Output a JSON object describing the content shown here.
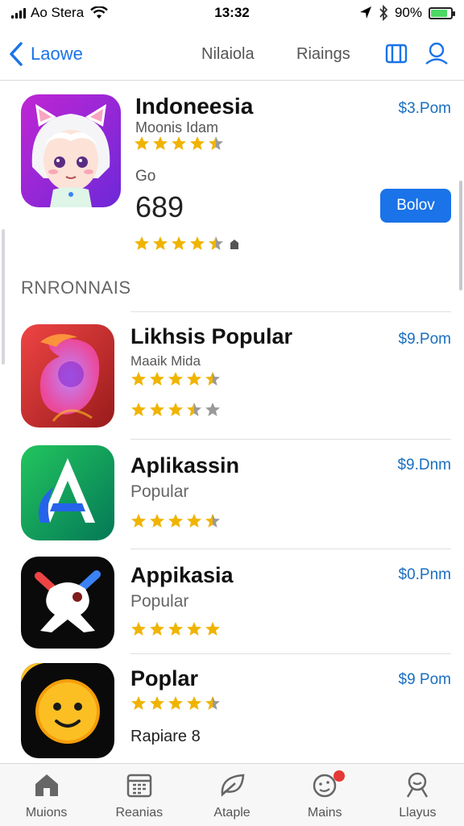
{
  "status_bar": {
    "carrier": "Ao Stera",
    "time": "13:32",
    "battery_percent": "90%",
    "battery_level": 0.85
  },
  "nav": {
    "back_label": "Laowe",
    "tabs": [
      "Nilaiola",
      "Riaings"
    ]
  },
  "featured": {
    "title": "Indoneesia",
    "subtitle": "Moonis Idam",
    "price": "$3.Pom",
    "rating": 4.5,
    "label": "Go",
    "count": "689",
    "button_label": "Bolov",
    "rating2": 4.5
  },
  "section": {
    "title": "RNRONNAIS"
  },
  "apps": [
    {
      "title": "Likhsis Popular",
      "subtitle": "Maaik Mida",
      "price": "$9.Pom",
      "ratings": [
        4.5,
        3.5
      ]
    },
    {
      "title": "Aplikassin",
      "subtitle": "Popular",
      "price": "$9.Dnm",
      "ratings": [
        4.5
      ]
    },
    {
      "title": "Appikasia",
      "subtitle": "Popular",
      "price": "$0.Pnm",
      "ratings": [
        5
      ]
    },
    {
      "title": "Poplar",
      "subtitle": "Rapiare 8",
      "price": "$9 Pom",
      "ratings": [
        4.5
      ]
    }
  ],
  "tab_bar": {
    "items": [
      "Muions",
      "Reanias",
      "Ataple",
      "Mains",
      "Llayus"
    ]
  },
  "colors": {
    "accent": "#1a73e8",
    "star": "#f0b400",
    "price": "#1a6fc0"
  }
}
